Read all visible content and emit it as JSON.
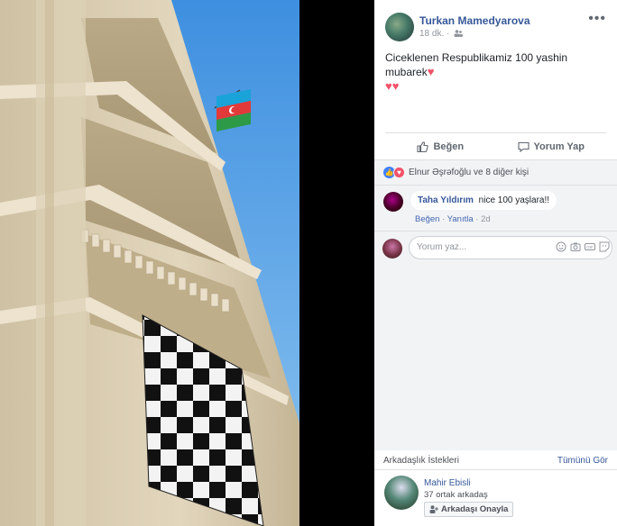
{
  "post": {
    "author": "Turkan Mamedyarova",
    "time": "18 dk.",
    "separator": "·",
    "text": "Ciceklenen Respublikamiz 100 yashin mubarek",
    "more_icon": "more-options-icon"
  },
  "actions": {
    "like_label": "Beğen",
    "comment_label": "Yorum Yap"
  },
  "reactions": {
    "names": "Elnur Əşrəfoğlu ve 8 diğer kişi"
  },
  "comment": {
    "name": "Taha Yıldırım",
    "text": "nice 100 yaşlara!!",
    "like_label": "Beğen",
    "reply_label": "Yanıtla",
    "dot": "·",
    "age": "2d"
  },
  "write_comment": {
    "placeholder": "Yorum yaz..."
  },
  "friend_requests": {
    "title": "Arkadaşlık İstekleri",
    "see_all": "Tümünü Gör",
    "name": "Mahir Ebisli",
    "mutual": "37 ortak arkadaş",
    "confirm_label": "Arkadaşı Onayla"
  },
  "colors": {
    "link_blue": "#365899",
    "sky": "#6fb0e8",
    "facade": "#d8cbb0",
    "love_red": "#f25268"
  }
}
